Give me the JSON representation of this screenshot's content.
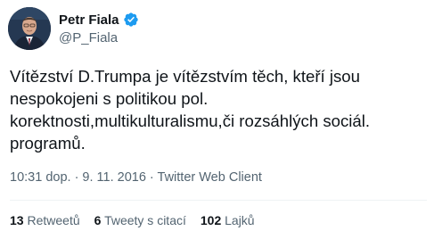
{
  "author": {
    "display_name": "Petr Fiala",
    "handle": "@P_Fiala",
    "verified": true,
    "verified_icon": "verified-badge-icon",
    "verified_color": "#1d9bf0"
  },
  "tweet": {
    "text": "Vítězství D.Trumpa je vítězstvím těch, kteří jsou\nnespokojeni s politikou pol.\nkorektnosti,multikulturalismu,či rozsáhlých sociál.\nprogramů.",
    "timestamp": "10:31 dop. · 9. 11. 2016 · Twitter Web Client"
  },
  "stats": {
    "retweets_count": "13",
    "retweets_label": "Retweetů",
    "quotes_count": "6",
    "quotes_label": "Tweety s citací",
    "likes_count": "102",
    "likes_label": "Lajků"
  }
}
